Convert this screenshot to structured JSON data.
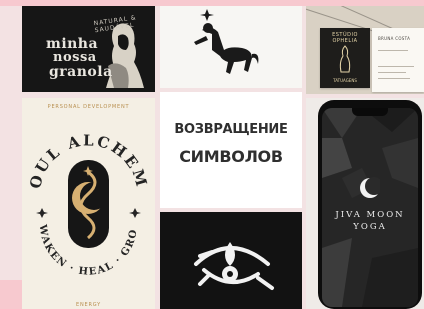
{
  "headline": {
    "line1": "ВОЗВРАЩЕНИЕ",
    "line2": "СИМВОЛОВ"
  },
  "granola": {
    "word1": "minha",
    "word2": "nossa",
    "word3": "granola",
    "tagline": "NATURAL & SAUDÁVEL"
  },
  "centaur": {
    "icon": "centaur-icon",
    "star_icon": "star-icon"
  },
  "business_card": {
    "front_name": "ESTÚDIO OPHELIA",
    "front_sub": "TATUAGENS",
    "back_name": "BRUNA COSTA"
  },
  "soul_alchemy": {
    "top_text": "PERSONAL DEVELOPMENT",
    "title": "SOUL ALCHEMY",
    "slogan": "AWAKEN · HEAL · GROW",
    "bottom_text": "ENERGY"
  },
  "eye_logo": {
    "icon": "eye-icon"
  },
  "jiva": {
    "line1": "JIVA MOON",
    "line2": "YOGA",
    "icon": "crescent-moon-icon"
  },
  "colors": {
    "background": "#f3e2e3",
    "accent_pink": "#f7c9cf",
    "gold": "#b88f4f",
    "dark": "#161616"
  }
}
